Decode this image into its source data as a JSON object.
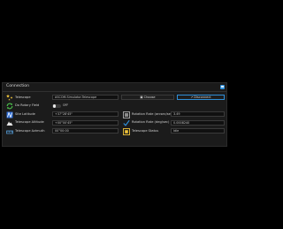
{
  "section": {
    "title": "Connection"
  },
  "telescope": {
    "label": "Telescope",
    "value": "ASCOM.Simulator.Telescope",
    "choose_label": "Choose",
    "connect_label": "Disconnect",
    "icon": "telescope-stars-icon"
  },
  "do_rotary_field": {
    "label": "Do Rotary Field",
    "toggle_text": "OFF",
    "enabled": false,
    "icon": "rotate-arrows-icon"
  },
  "site_latitude": {
    "label": "Site Latitude",
    "value": "+37°28'45\"",
    "icon": "latitude-map-icon"
  },
  "telescope_altitude": {
    "label": "Telescope Altitude",
    "value": "+00°00'45\"",
    "icon": "mountain-altitude-icon"
  },
  "telescope_azimuth": {
    "label": "Telescope Azimuth",
    "value": "00°00:00",
    "icon": "azimuth-ruler-icon"
  },
  "rotation_rate_arcsec": {
    "label": "Rotation Rate (arcsec/sec)",
    "value": "3.49",
    "icon": "image-frame-icon"
  },
  "rotation_rate_deg": {
    "label": "Rotation Rate (deg/sec)",
    "value": "0.0008240",
    "icon": "chart-check-icon"
  },
  "telescope_status": {
    "label": "Telescope Status",
    "value": "Idle",
    "icon": "status-frame-icon"
  },
  "colors": {
    "accent": "#2f8fd8",
    "panel": "#1b1b1b",
    "background": "#000000"
  }
}
